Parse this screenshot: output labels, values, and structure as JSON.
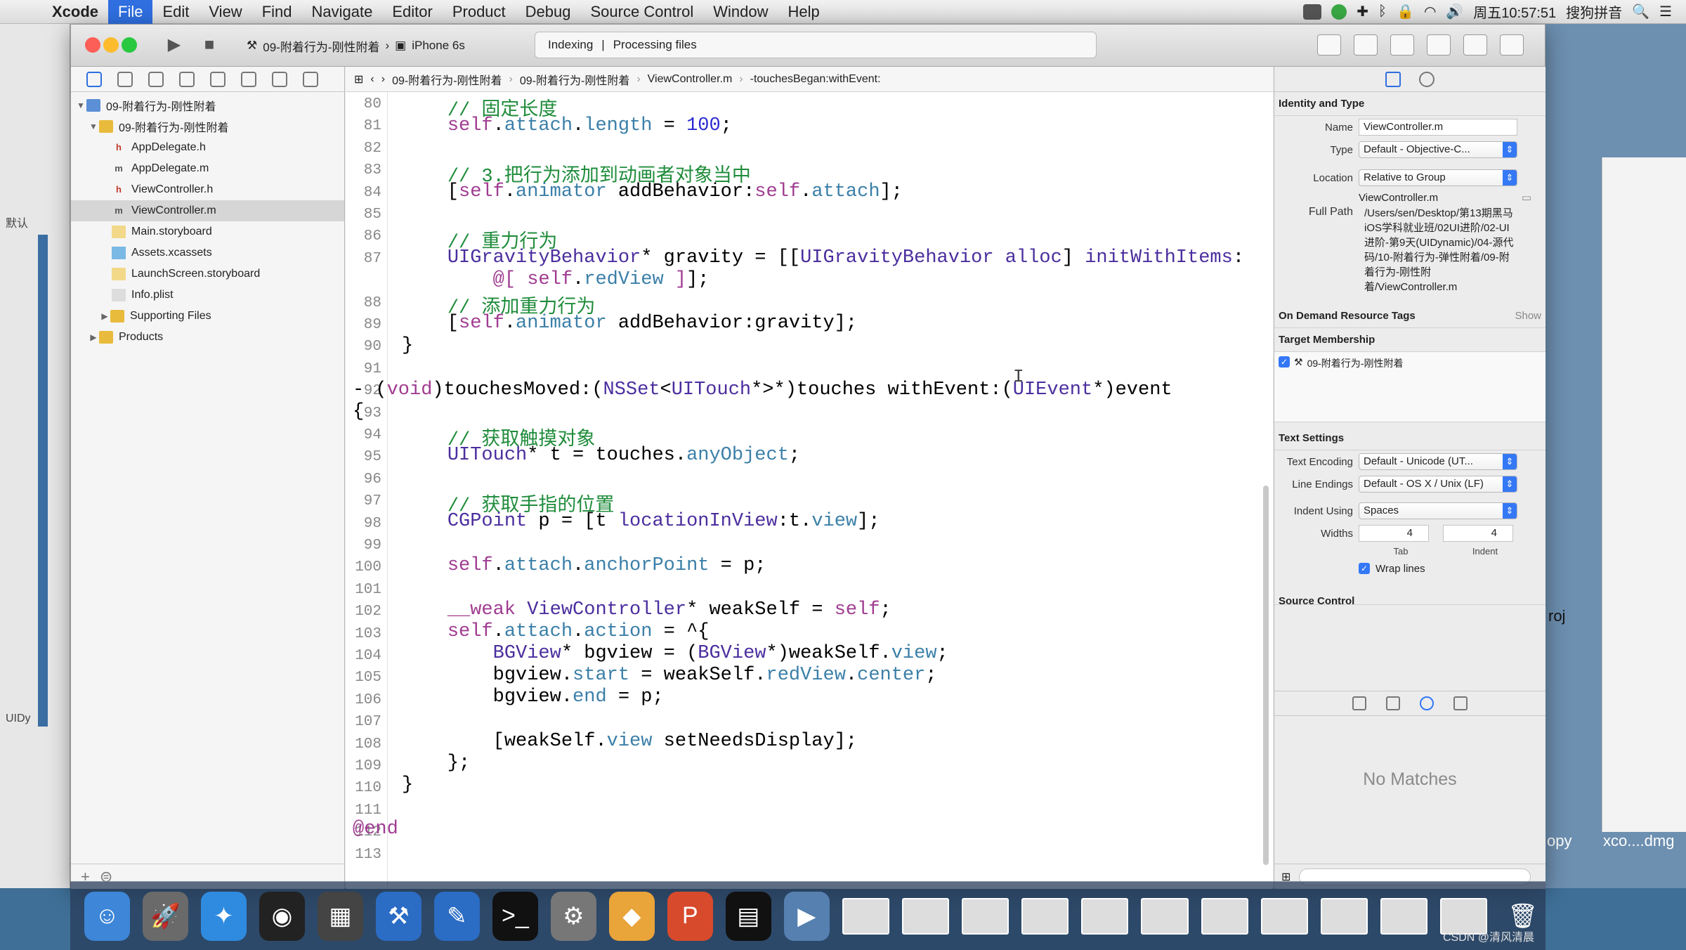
{
  "menubar": {
    "app": "Xcode",
    "items": [
      "File",
      "Edit",
      "View",
      "Find",
      "Navigate",
      "Editor",
      "Product",
      "Debug",
      "Source Control",
      "Window",
      "Help"
    ],
    "clock": "周五10:57:51",
    "input_method": "搜狗拼音"
  },
  "toolbar": {
    "scheme": "09-附着行为-刚性附着",
    "device": "iPhone 6s",
    "activity_left": "Indexing",
    "activity_right": "Processing files"
  },
  "desktop": {
    "left_label_1": "默认",
    "left_label_2": "UIDy",
    "right_text_1": "roj",
    "right_text_2": "opy",
    "right_text_3": "xco....dmg"
  },
  "navigator": {
    "project": "09-附着行为-刚性附着",
    "group": "09-附着行为-刚性附着",
    "files": [
      {
        "name": "AppDelegate.h",
        "icon": "h"
      },
      {
        "name": "AppDelegate.m",
        "icon": "m"
      },
      {
        "name": "ViewController.h",
        "icon": "h"
      },
      {
        "name": "ViewController.m",
        "icon": "m"
      },
      {
        "name": "Main.storyboard",
        "icon": "sb"
      },
      {
        "name": "Assets.xcassets",
        "icon": "as"
      },
      {
        "name": "LaunchScreen.storyboard",
        "icon": "sb"
      },
      {
        "name": "Info.plist",
        "icon": "pl"
      }
    ],
    "supporting": "Supporting Files",
    "products": "Products"
  },
  "jumpbar": {
    "crumb1": "09-附着行为-刚性附着",
    "crumb2": "09-附着行为-刚性附着",
    "crumb3": "ViewController.m",
    "crumb4": "-touchesBegan:withEvent:"
  },
  "code": {
    "line_numbers": [
      "80",
      "81",
      "82",
      "83",
      "84",
      "85",
      "86",
      "87",
      "",
      "88",
      "89",
      "90",
      "91",
      "92",
      "93",
      "94",
      "95",
      "96",
      "97",
      "98",
      "99",
      "100",
      "101",
      "102",
      "103",
      "104",
      "105",
      "106",
      "107",
      "108",
      "109",
      "110",
      "111",
      "112",
      "113"
    ]
  },
  "inspector": {
    "identity_title": "Identity and Type",
    "name_label": "Name",
    "name_value": "ViewController.m",
    "type_label": "Type",
    "type_value": "Default - Objective-C...",
    "location_label": "Location",
    "location_value": "Relative to Group",
    "location_file": "ViewController.m",
    "fullpath_label": "Full Path",
    "fullpath_value": "/Users/sen/Desktop/第13期黑马iOS学科就业班/02UI进阶/02-UI进阶-第9天(UIDynamic)/04-源代码/10-附着行为-弹性附着/09-附着行为-刚性附着/ViewController.m",
    "ondemand_title": "On Demand Resource Tags",
    "ondemand_show": "Show",
    "target_title": "Target Membership",
    "target_item": "09-附着行为-刚性附着",
    "text_title": "Text Settings",
    "encoding_label": "Text Encoding",
    "encoding_value": "Default - Unicode (UT...",
    "endings_label": "Line Endings",
    "endings_value": "Default - OS X / Unix (LF)",
    "indent_label": "Indent Using",
    "indent_value": "Spaces",
    "widths_label": "Widths",
    "tab_value": "4",
    "tab_label": "Tab",
    "indent_width_value": "4",
    "indent_width_label": "Indent",
    "wrap_label": "Wrap lines",
    "source_title": "Source Control",
    "no_matches": "No Matches"
  },
  "watermark": "CSDN @清风清晨"
}
